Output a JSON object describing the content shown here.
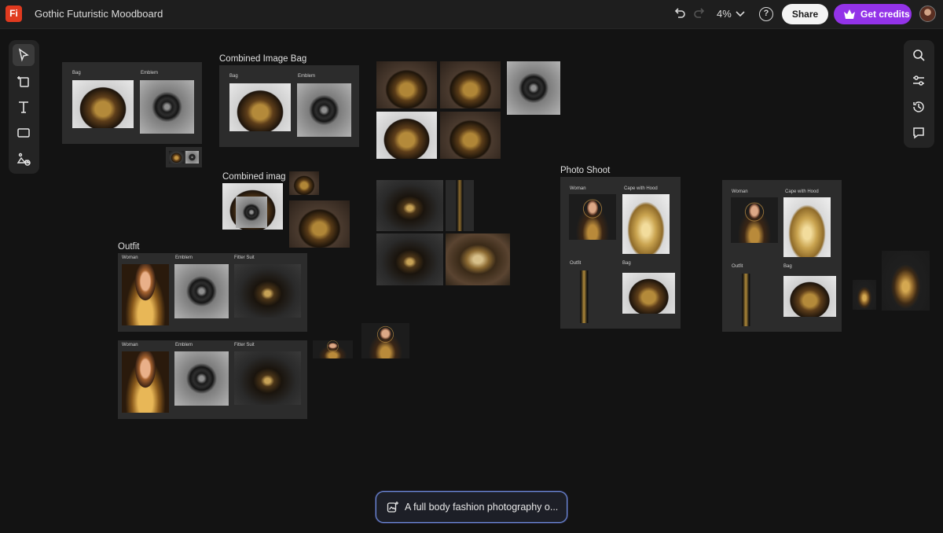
{
  "app": {
    "logo_text": "Fi",
    "document_title": "Gothic Futuristic Moodboard",
    "brand_color": "#e03a1f"
  },
  "header": {
    "zoom": "4%",
    "share_label": "Share",
    "credits_label": "Get credits",
    "credits_color": "#9333e8",
    "help_label": "?"
  },
  "tools_left": [
    {
      "name": "select-tool",
      "icon": "cursor-icon"
    },
    {
      "name": "add-page-tool",
      "icon": "add-page-icon"
    },
    {
      "name": "text-tool",
      "icon": "text-icon"
    },
    {
      "name": "shape-tool",
      "icon": "rectangle-icon"
    },
    {
      "name": "generate-tool",
      "icon": "generate-image-icon"
    }
  ],
  "tools_right": [
    {
      "name": "search-tool",
      "icon": "search-icon"
    },
    {
      "name": "adjust-tool",
      "icon": "sliders-icon"
    },
    {
      "name": "history-tool",
      "icon": "history-icon"
    },
    {
      "name": "comments-tool",
      "icon": "comment-icon"
    }
  ],
  "canvas": {
    "board1": {
      "bag": "Bag",
      "emblem": "Emblem"
    },
    "combined_bag": {
      "title": "Combined Image Bag",
      "bag": "Bag",
      "emblem": "Emblem"
    },
    "combined_img": {
      "title": "Combined imag"
    },
    "outfit": {
      "title": "Outfit",
      "woman": "Woman",
      "emblem": "Emblem",
      "suit": "Fitter Suit"
    },
    "outfit2": {
      "woman": "Woman",
      "emblem": "Emblem",
      "suit": "Fitter Suit"
    },
    "photo": {
      "title": "Photo Shoot",
      "woman": "Woman",
      "cape": "Cape with Hood",
      "outfit": "Outfit",
      "bag": "Bag"
    },
    "photo2": {
      "woman": "Woman",
      "cape": "Cape with Hood",
      "outfit": "Outfit",
      "bag": "Bag"
    }
  },
  "prompt": {
    "text": "A full body fashion photography o..."
  }
}
